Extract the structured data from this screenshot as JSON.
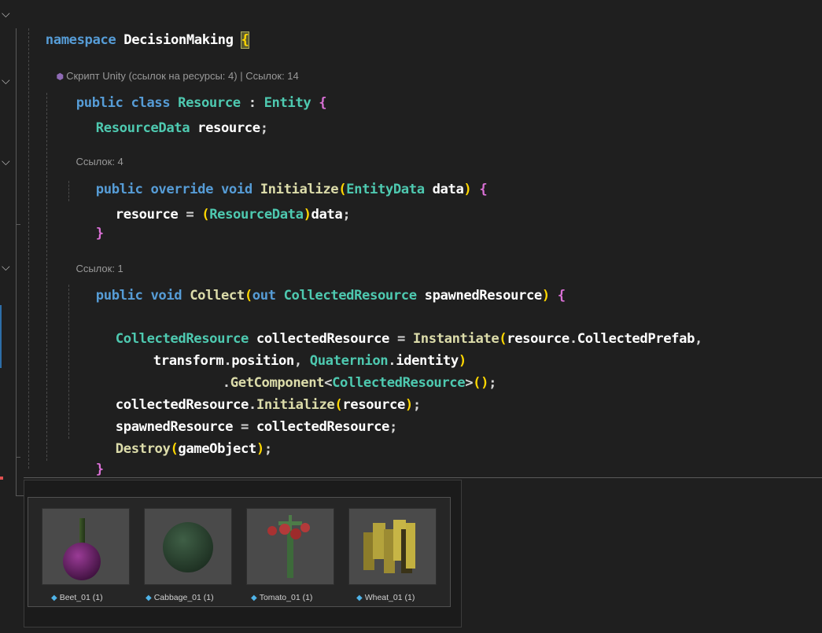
{
  "code": {
    "namespace_keyword": "namespace",
    "namespace_name": "DecisionMaking",
    "lens_class": "Скрипт Unity (ссылок на ресурсы: 4) | Ссылок: 14",
    "lens_initialize": "Ссылок: 4",
    "lens_collect": "Ссылок: 1",
    "class_decl": [
      "public",
      "class",
      "Resource",
      ":",
      "Entity",
      "{"
    ],
    "field_type": "ResourceData",
    "field_name": "resource",
    "init_sig": [
      "public",
      "override",
      "void",
      "Initialize",
      "EntityData",
      "data"
    ],
    "init_body": [
      "resource",
      "ResourceData",
      "data"
    ],
    "collect_sig": [
      "public",
      "void",
      "Collect",
      "out",
      "CollectedResource",
      "spawnedResource"
    ],
    "line_inst": [
      "CollectedResource",
      "collectedResource",
      "Instantiate",
      "resource",
      "CollectedPrefab"
    ],
    "line_inst2": [
      "transform",
      "position",
      "Quaternion",
      "identity"
    ],
    "line_inst3": [
      "GetComponent",
      "CollectedResource"
    ],
    "line_init_call": [
      "collectedResource",
      "Initialize",
      "resource"
    ],
    "line_assign": [
      "spawnedResource",
      "collectedResource"
    ],
    "line_destroy": [
      "Destroy",
      "gameObject"
    ]
  },
  "preview": {
    "items": [
      {
        "label": "Beet_01 (1)",
        "icon": "prefab-cube-icon"
      },
      {
        "label": "Cabbage_01 (1)",
        "icon": "prefab-cube-icon"
      },
      {
        "label": "Tomato_01 (1)",
        "icon": "prefab-cube-icon"
      },
      {
        "label": "Wheat_01 (1)",
        "icon": "prefab-cube-icon"
      }
    ]
  },
  "colors": {
    "background": "#1f1f1f",
    "keyword": "#569cd6",
    "type": "#4ec9b0",
    "method": "#dcdcaa",
    "variable": "#9cdcfe",
    "bracket_gold": "#ffd700",
    "bracket_purple": "#da70d6"
  }
}
